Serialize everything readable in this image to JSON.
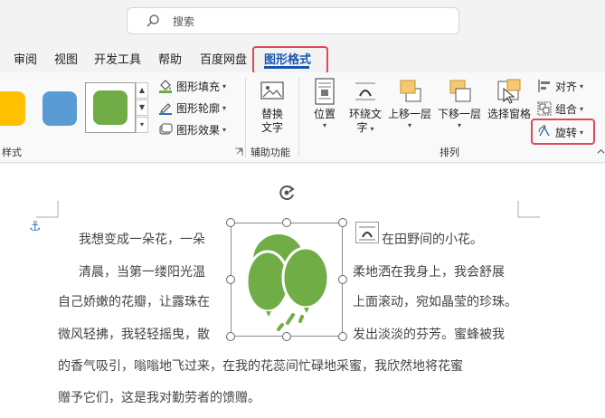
{
  "search": {
    "placeholder": "搜索"
  },
  "tabs": [
    {
      "label": "审阅"
    },
    {
      "label": "视图"
    },
    {
      "label": "开发工具"
    },
    {
      "label": "帮助"
    },
    {
      "label": "百度网盘"
    },
    {
      "label": "图形格式",
      "active": true
    }
  ],
  "ribbon": {
    "style_group": {
      "label": "样式",
      "swatch_colors": [
        "#ffc000",
        "#5b9bd5",
        "#70ad47"
      ],
      "fill": "图形填充",
      "outline": "图形轮廓",
      "effect": "图形效果"
    },
    "accessibility_group": {
      "label": "辅助功能",
      "alt_text_line1": "替换",
      "alt_text_line2": "文字"
    },
    "arrange_group": {
      "label": "排列",
      "position": "位置",
      "wrap_line1": "环绕文",
      "wrap_line2": "字",
      "bring_forward": "上移一层",
      "send_backward": "下移一层",
      "selection_pane": "选择窗格",
      "align": "对齐",
      "group": "组合",
      "rotate": "旋转"
    }
  },
  "document": {
    "lines": [
      {
        "before": "我想变成一朵花，一朵",
        "after": "在田野间的小花。"
      },
      {
        "before": "清晨，当第一缕阳光温",
        "after": "柔地洒在我身上，我会舒展"
      },
      {
        "before": "自己娇嫩的花瓣，让露珠在",
        "after": "上面滚动，宛如晶莹的珍珠。"
      },
      {
        "before": "微风轻拂，我轻轻摇曳，散",
        "after": "发出淡淡的芬芳。蜜蜂被我"
      },
      {
        "full": "的香气吸引，嗡嗡地飞过来，在我的花蕊间忙碌地采蜜，我欣然地将花蜜"
      },
      {
        "full": "赠予它们，这是我对勤劳者的馈赠。"
      }
    ],
    "shape_color": "#70ad47",
    "shape_icon": "balloons-icon"
  },
  "colors": {
    "accent": "#1a56b0",
    "highlight": "#e0475a",
    "anchor": "#3d7fc6"
  }
}
